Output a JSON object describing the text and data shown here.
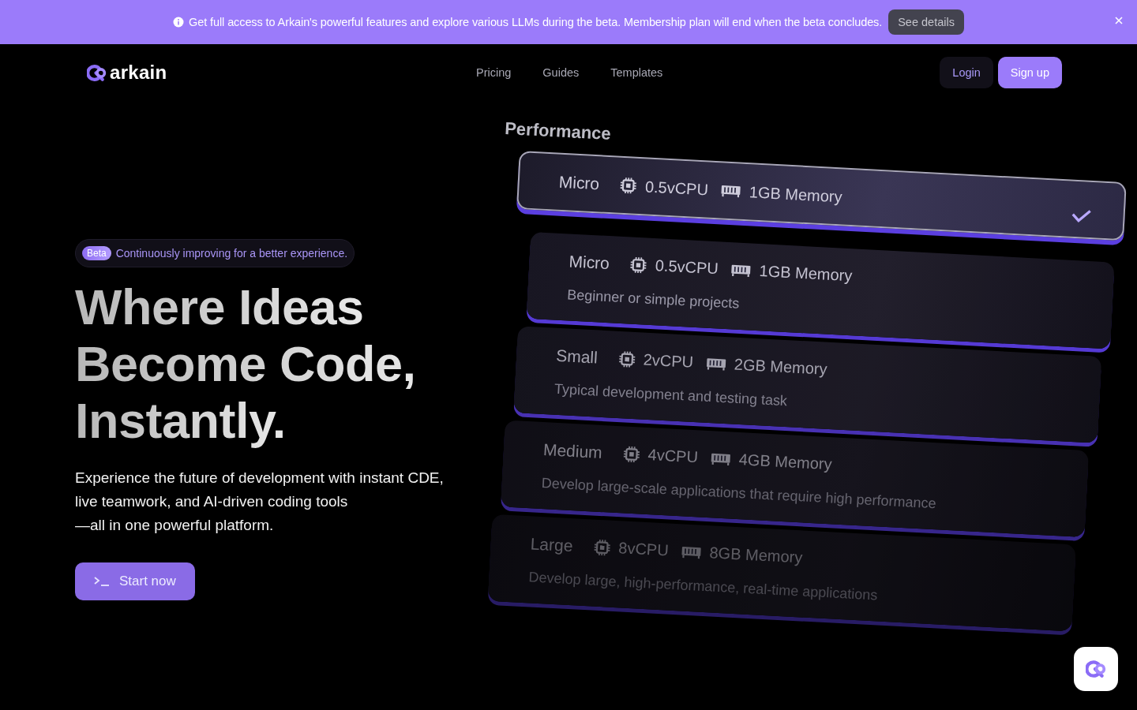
{
  "banner": {
    "message": "Get full access to Arkain's powerful features and explore various LLMs during the beta. Membership plan will end when the beta concludes.",
    "button": "See details"
  },
  "nav": {
    "logo_text": "arkain",
    "links": [
      "Pricing",
      "Guides",
      "Templates"
    ],
    "login": "Login",
    "signup": "Sign up"
  },
  "hero": {
    "badge": "Beta",
    "badge_text": "Continuously improving for a better experience.",
    "headline": [
      "Where Ideas",
      "Become Code,",
      "Instantly."
    ],
    "description": [
      "Experience the future of development with instant CDE,",
      "live teamwork, and AI-driven coding tools",
      "—all in one powerful platform."
    ],
    "cta": "Start now"
  },
  "illustration": {
    "title": "Performance",
    "selected": {
      "name": "Micro",
      "cpu": "0.5vCPU",
      "memory": "1GB Memory"
    },
    "plans": [
      {
        "name": "Micro",
        "cpu": "0.5vCPU",
        "memory": "1GB Memory",
        "description": "Beginner or simple projects"
      },
      {
        "name": "Small",
        "cpu": "2vCPU",
        "memory": "2GB Memory",
        "description": "Typical development and testing task"
      },
      {
        "name": "Medium",
        "cpu": "4vCPU",
        "memory": "4GB Memory",
        "description": "Develop large-scale applications that require high performance"
      },
      {
        "name": "Large",
        "cpu": "8vCPU",
        "memory": "8GB Memory",
        "description": "Develop large, high-performance, real-time applications"
      }
    ]
  }
}
